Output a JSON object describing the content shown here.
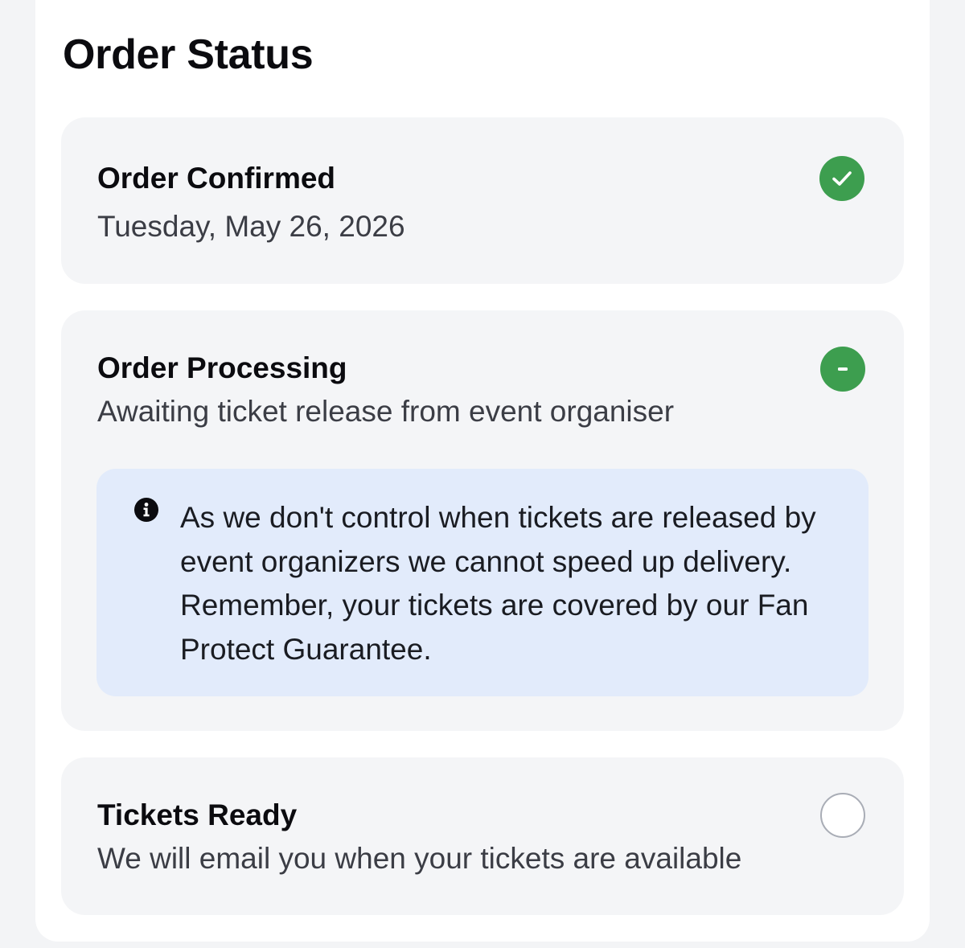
{
  "page": {
    "title": "Order Status"
  },
  "steps": [
    {
      "title": "Order Confirmed",
      "subtitle": "Tuesday, May 26, 2026",
      "status": "complete",
      "icon": "check-circle-icon",
      "icon_color": "#3d9e4f"
    },
    {
      "title": "Order Processing",
      "subtitle": "Awaiting ticket release from event organiser",
      "status": "in-progress",
      "icon": "minus-circle-icon",
      "icon_color": "#3d9e4f",
      "notice": {
        "icon": "info-icon",
        "text": "As we don't control when tickets are released by event organizers we cannot speed up delivery. Remember, your tickets are covered by our Fan Protect Guarantee.",
        "background": "#e2ebfb"
      }
    },
    {
      "title": "Tickets Ready",
      "subtitle": "We will email you when your tickets are available",
      "status": "pending",
      "icon": "empty-circle-icon",
      "icon_color": "#a9adb6"
    }
  ]
}
